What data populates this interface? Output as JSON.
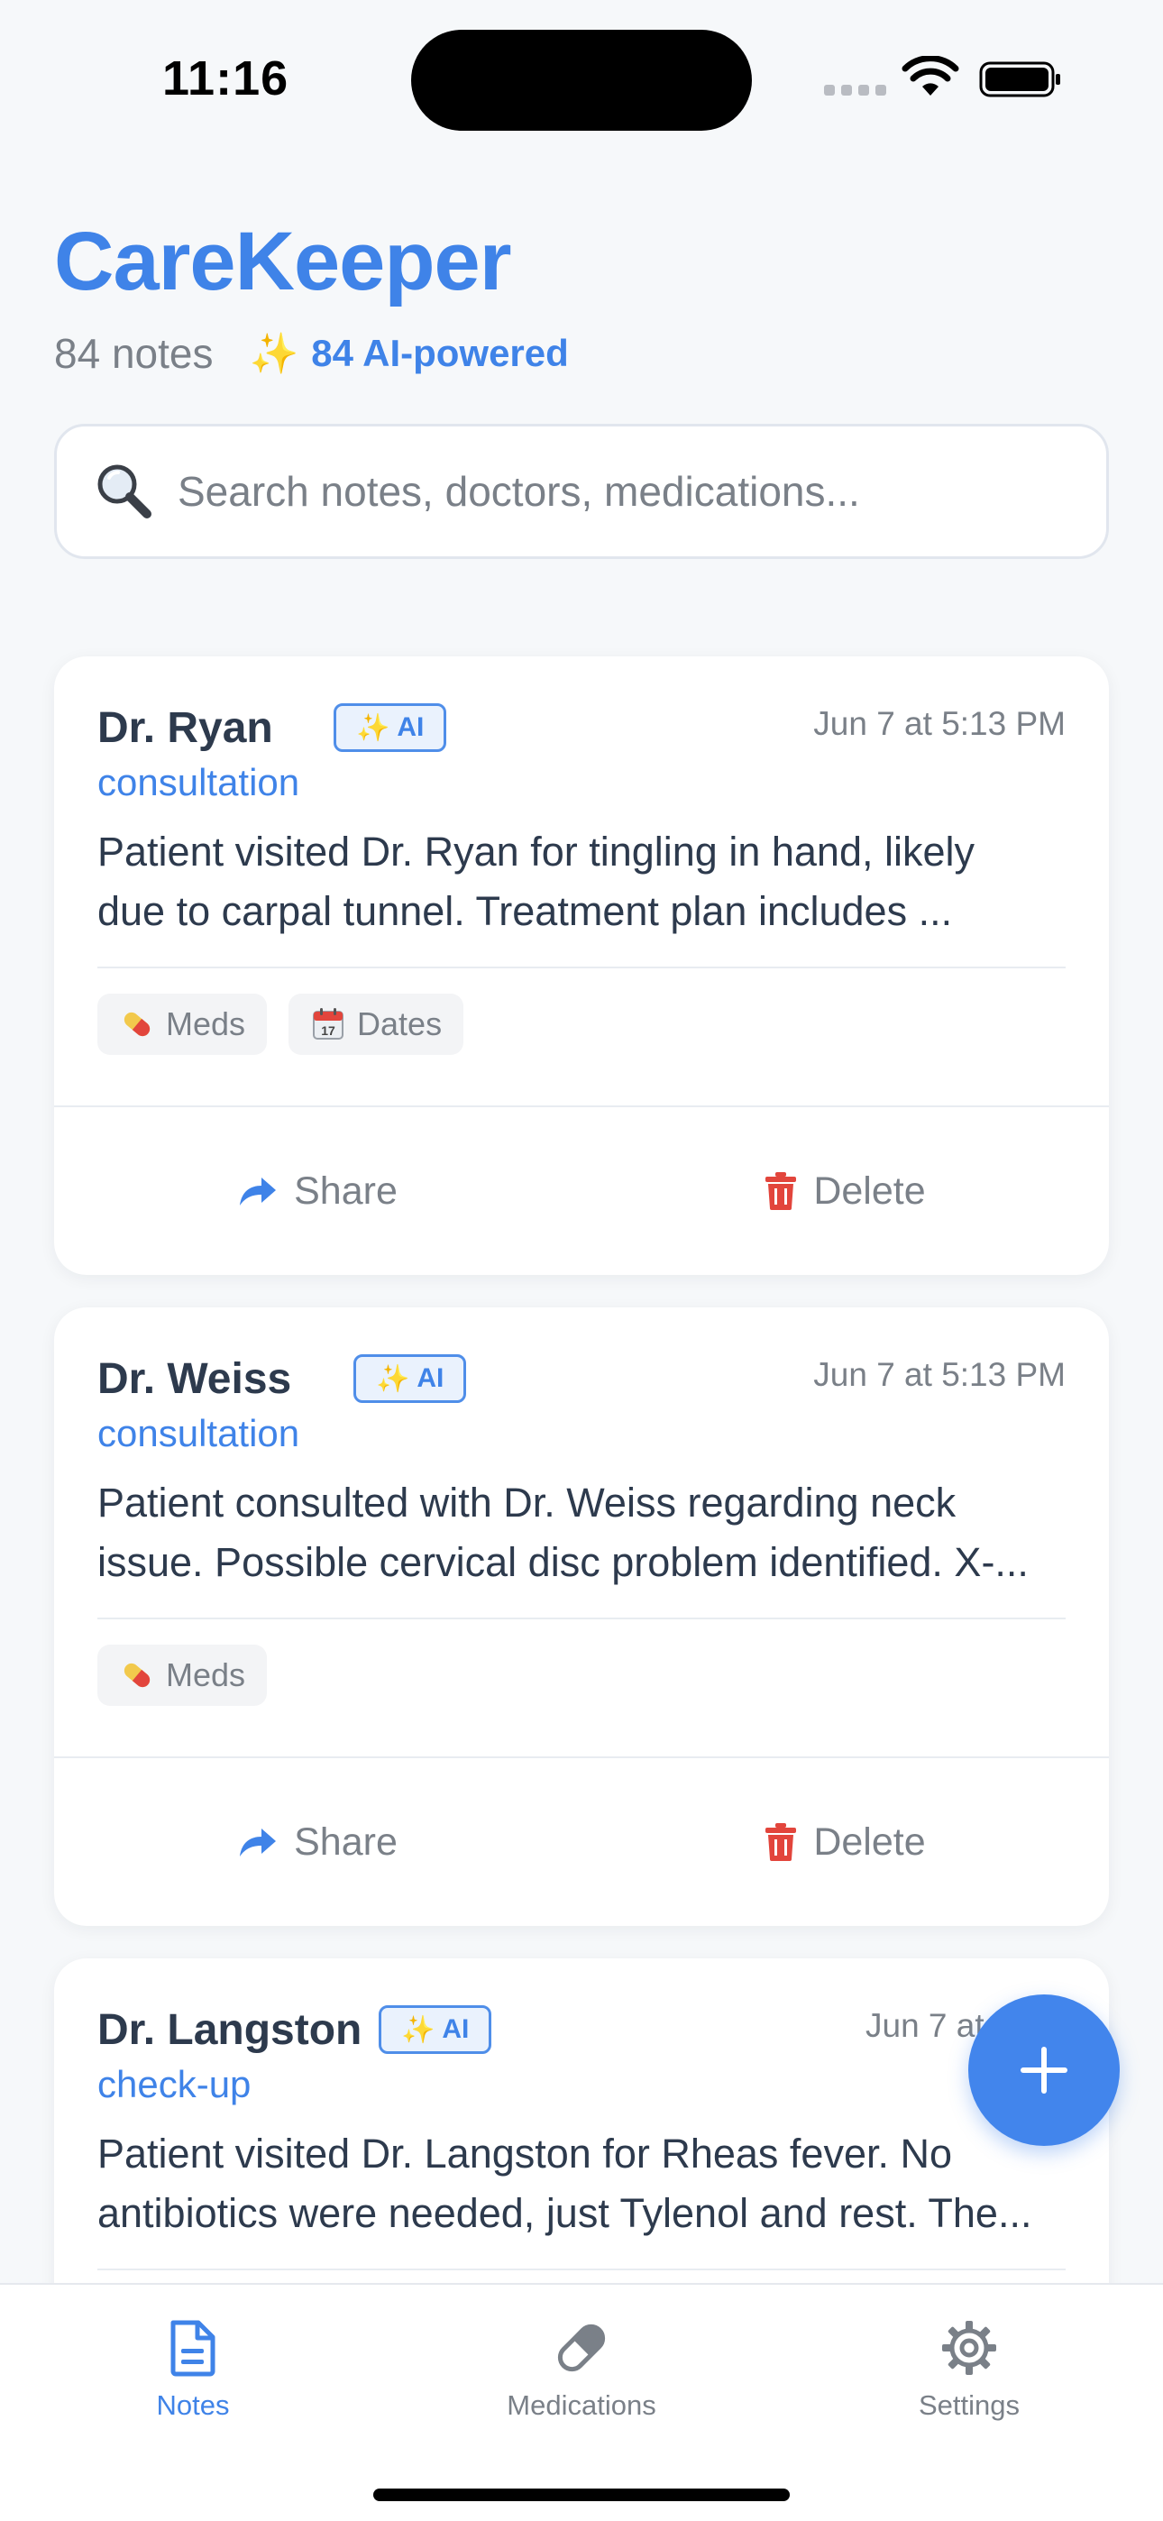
{
  "status_bar": {
    "time": "11:16"
  },
  "header": {
    "title": "CareKeeper",
    "note_count": "84 notes",
    "ai_icon": "sparkles-icon",
    "ai_count": "84 AI-powered"
  },
  "search": {
    "placeholder": "Search notes, doctors, medications..."
  },
  "notes": [
    {
      "doctor": "Dr. Ryan",
      "ai_label": "AI",
      "datetime": "Jun 7 at 5:13 PM",
      "category": "consultation",
      "summary_line1": "Patient visited Dr. Ryan for tingling in hand, likely",
      "summary_line2": "due to carpal tunnel. Treatment plan includes ...",
      "tags": [
        {
          "icon": "pill-icon",
          "label": "Meds"
        },
        {
          "icon": "calendar-icon",
          "label": "Dates"
        }
      ],
      "share_label": "Share",
      "delete_label": "Delete"
    },
    {
      "doctor": "Dr. Weiss",
      "ai_label": "AI",
      "datetime": "Jun 7 at 5:13 PM",
      "category": "consultation",
      "summary_line1": "Patient consulted with Dr. Weiss regarding neck",
      "summary_line2": "issue. Possible cervical disc problem identified. X-...",
      "tags": [
        {
          "icon": "pill-icon",
          "label": "Meds"
        }
      ],
      "share_label": "Share",
      "delete_label": "Delete"
    },
    {
      "doctor": "Dr. Langston",
      "ai_label": "AI",
      "datetime": "Jun 7 at 4:3",
      "category": "check-up",
      "summary_line1": "Patient visited Dr. Langston for Rheas fever. No",
      "summary_line2": "antibiotics were needed, just Tylenol and rest. The..."
    }
  ],
  "tab_bar": {
    "tabs": [
      {
        "label": "Notes",
        "icon": "document-icon",
        "active": true
      },
      {
        "label": "Medications",
        "icon": "pill-icon",
        "active": false
      },
      {
        "label": "Settings",
        "icon": "gear-icon",
        "active": false
      }
    ]
  },
  "colors": {
    "accent": "#3f83e8",
    "danger": "#e2453c",
    "background": "#f6f8fa",
    "muted_text": "#7a8088"
  }
}
